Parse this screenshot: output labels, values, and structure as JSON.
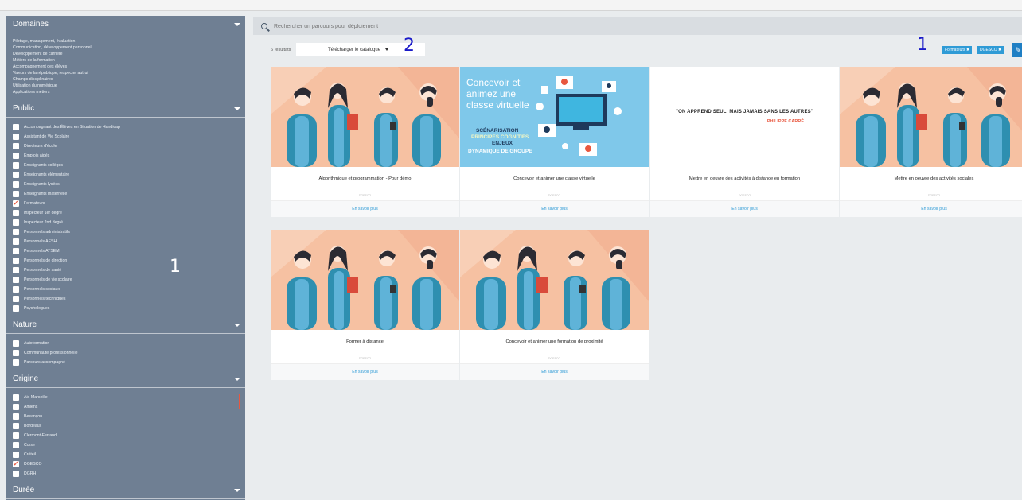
{
  "sidebar": {
    "domaines": {
      "title": "Domaines",
      "items": [
        "Pilotage, management, évaluation",
        "Communication, développement personnel",
        "Développement de carrière",
        "Métiers de la formation",
        "Accompagnement des élèves",
        "Valeurs de la république, respecter autrui",
        "Champs disciplinaires",
        "Utilisation du numérique",
        "Applications métiers"
      ]
    },
    "public": {
      "title": "Public",
      "items": [
        {
          "label": "Accompagnant des Élèves en Situation de Handicap",
          "checked": false
        },
        {
          "label": "Assistant de Vie Scolaire",
          "checked": false
        },
        {
          "label": "Directeurs d'école",
          "checked": false
        },
        {
          "label": "Emplois aidés",
          "checked": false
        },
        {
          "label": "Enseignants collèges",
          "checked": false
        },
        {
          "label": "Enseignants élémentaire",
          "checked": false
        },
        {
          "label": "Enseignants lycées",
          "checked": false
        },
        {
          "label": "Enseignants maternelle",
          "checked": false
        },
        {
          "label": "Formateurs",
          "checked": true
        },
        {
          "label": "Inspecteur 1er degré",
          "checked": false
        },
        {
          "label": "Inspecteur 2nd degré",
          "checked": false
        },
        {
          "label": "Personnels administratifs",
          "checked": false
        },
        {
          "label": "Personnels AESH",
          "checked": false
        },
        {
          "label": "Personnels ATSEM",
          "checked": false
        },
        {
          "label": "Personnels de direction",
          "checked": false
        },
        {
          "label": "Personnels de santé",
          "checked": false
        },
        {
          "label": "Personnels de vie scolaire",
          "checked": false
        },
        {
          "label": "Personnels sociaux",
          "checked": false
        },
        {
          "label": "Personnels techniques",
          "checked": false
        },
        {
          "label": "Psychologues",
          "checked": false
        }
      ]
    },
    "nature": {
      "title": "Nature",
      "items": [
        {
          "label": "Autoformation",
          "checked": false
        },
        {
          "label": "Communauté professionnelle",
          "checked": false
        },
        {
          "label": "Parcours accompagné",
          "checked": false
        }
      ]
    },
    "origine": {
      "title": "Origine",
      "items": [
        {
          "label": "Aix-Marseille",
          "checked": false
        },
        {
          "label": "Amiens",
          "checked": false
        },
        {
          "label": "Besançon",
          "checked": false
        },
        {
          "label": "Bordeaux",
          "checked": false
        },
        {
          "label": "Clermont-Ferrand",
          "checked": false
        },
        {
          "label": "Corse",
          "checked": false
        },
        {
          "label": "Créteil",
          "checked": false
        },
        {
          "label": "DGESCO",
          "checked": true
        },
        {
          "label": "DGRH",
          "checked": false
        }
      ]
    },
    "duree": {
      "title": "Durée"
    }
  },
  "annotations": {
    "sidebar_number": "1",
    "tags_number": "1",
    "download_number": "2"
  },
  "search": {
    "placeholder": "Rechercher un parcours pour déploiement"
  },
  "toolbar": {
    "results": "6 résultats",
    "download_label": "Télécharger le catalogue"
  },
  "active_filters": [
    "Formateurs ✖",
    "DGESCO ✖"
  ],
  "edit_icon": "pencil-icon",
  "cards": [
    {
      "title": "Algorithmique et programmation - Pour démo",
      "owner": "DGESCO",
      "more": "En savoir plus",
      "image": "illustration-people"
    },
    {
      "title": "Concevoir et animer une classe virtuelle",
      "owner": "DGESCO",
      "more": "En savoir plus",
      "image": "virtual-class",
      "image_text": {
        "line1": "Concevoir et",
        "line2": "animez une",
        "line3": "classe virtuelle",
        "k1": "SCÉNARISATION",
        "k2": "PRINCIPES COGNITIFS",
        "k3": "ENJEUX",
        "k4": "DYNAMIQUE DE GROUPE"
      }
    },
    {
      "title": "Mettre en oeuvre des activités à distance en formation",
      "owner": "DGESCO",
      "more": "En savoir plus",
      "image": "quote",
      "quote": "\"ON APPREND SEUL, MAIS JAMAIS SANS LES AUTRES\"",
      "quote_author": "PHILIPPE CARRÉ"
    },
    {
      "title": "Mettre en oeuvre des activités sociales",
      "owner": "DGESCO",
      "more": "En savoir plus",
      "image": "illustration-people"
    },
    {
      "title": "Former à distance",
      "owner": "DGESCO",
      "more": "En savoir plus",
      "image": "illustration-people"
    },
    {
      "title": "Concevoir et animer une formation de proximité",
      "owner": "DGESCO",
      "more": "En savoir plus",
      "image": "illustration-people"
    }
  ],
  "colors": {
    "sidebar": "#6f7f93",
    "accent": "#2f9bd6",
    "checkmark": "#e8573f",
    "annotation": "#1a1ac8"
  }
}
